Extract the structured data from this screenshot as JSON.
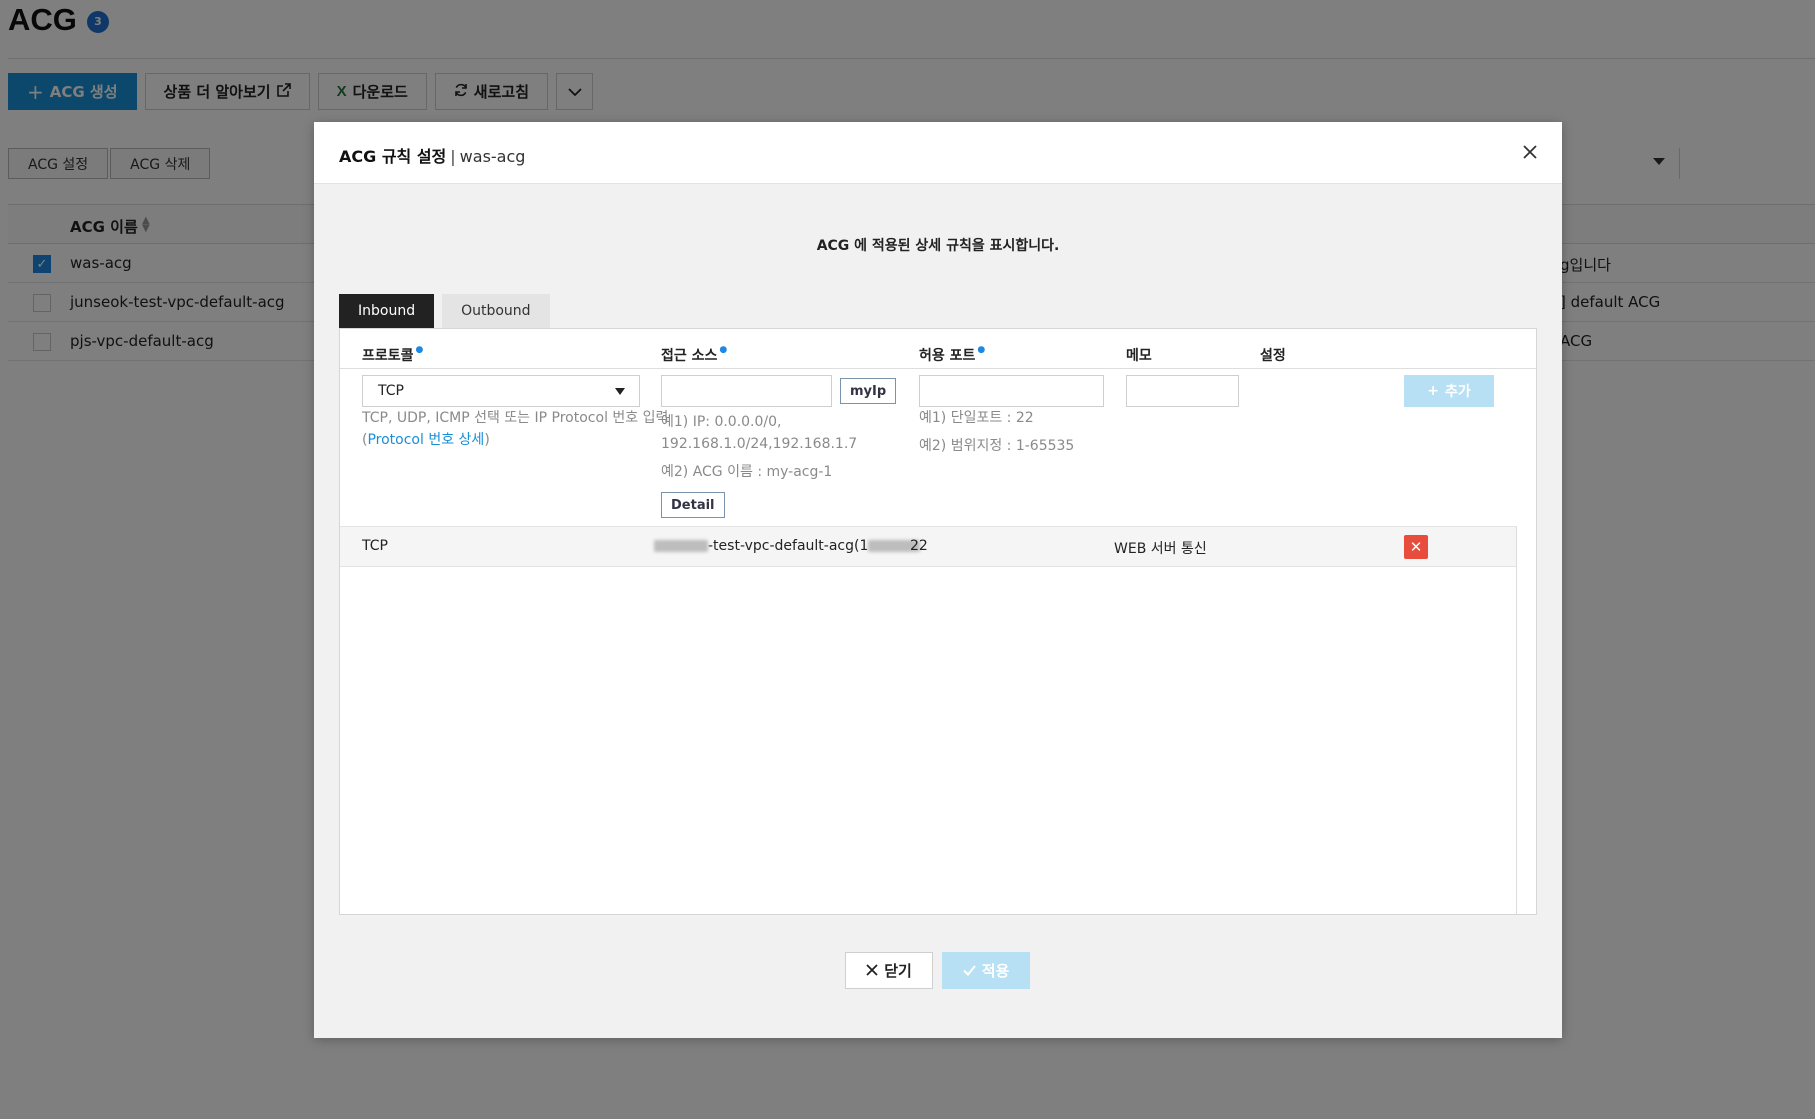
{
  "page": {
    "title": "ACG",
    "count": "3",
    "toolbar": {
      "create_label": "ACG 생성",
      "learn_more_label": "상품 더 알아보기",
      "download_label": "다운로드",
      "refresh_label": "새로고침"
    },
    "actions": {
      "settings_label": "ACG 설정",
      "delete_label": "ACG 삭제"
    },
    "table": {
      "name_header": "ACG 이름",
      "rows": [
        {
          "name": "was-acg",
          "desc": "g입니다",
          "checked": true
        },
        {
          "name": "junseok-test-vpc-default-acg",
          "desc": "] default ACG",
          "checked": false
        },
        {
          "name": "pjs-vpc-default-acg",
          "desc": "ACG",
          "checked": false
        }
      ]
    }
  },
  "modal": {
    "title": "ACG 규칙 설정",
    "separator": "|",
    "subtitle": "was-acg",
    "description": "ACG 에 적용된 상세 규칙을 표시합니다.",
    "tabs": [
      "Inbound",
      "Outbound"
    ],
    "active_tab": "Inbound",
    "columns": {
      "protocol": "프로토콜",
      "source": "접근 소스",
      "port": "허용 포트",
      "memo": "메모",
      "settings": "설정"
    },
    "form": {
      "protocol_value": "TCP",
      "protocol_hint": "TCP, UDP, ICMP 선택 또는 IP Protocol 번호 입력",
      "protocol_hint_open": "(",
      "protocol_link": "Protocol 번호 상세",
      "protocol_hint_close": ")",
      "source_value": "",
      "myip_label": "myIp",
      "source_hint_1a": "예1) IP: 0.0.0.0/0,",
      "source_hint_1b": "192.168.1.0/24,192.168.1.7",
      "source_hint_2": "예2) ACG 이름 : my-acg-1",
      "detail_label": "Detail",
      "port_value": "",
      "port_hint_1": "예1) 단일포트 : 22",
      "port_hint_2": "예2) 범위지정 : 1-65535",
      "memo_value": "",
      "add_label": "추가"
    },
    "rules": [
      {
        "protocol": "TCP",
        "source_visible": "-test-vpc-default-acg(1",
        "port": "22",
        "memo": "WEB 서버 통신"
      }
    ],
    "close_label": "닫기",
    "apply_label": "적용"
  },
  "colors": {
    "primary": "#1991d6",
    "badge": "#1e6fd1",
    "delete": "#e74c3c",
    "disabled_button": "#b7e0f5",
    "active_tab": "#222222"
  }
}
